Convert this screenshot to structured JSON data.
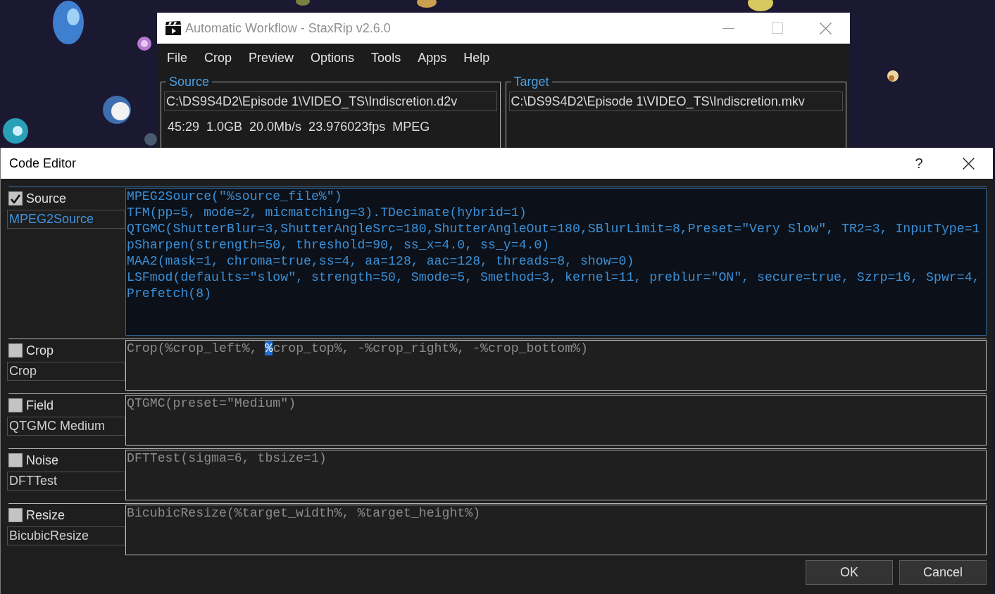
{
  "main_window": {
    "title": "Automatic Workflow - StaxRip v2.6.0",
    "menu": [
      "File",
      "Crop",
      "Preview",
      "Options",
      "Tools",
      "Apps",
      "Help"
    ],
    "source": {
      "label": "Source",
      "path": "C:\\DS9S4D2\\Episode 1\\VIDEO_TS\\Indiscretion.d2v",
      "info": "45:29  1.0GB  20.0Mb/s  23.976023fps  MPEG"
    },
    "target": {
      "label": "Target",
      "path": "C:\\DS9S4D2\\Episode 1\\VIDEO_TS\\Indiscretion.mkv"
    }
  },
  "code_editor": {
    "title": "Code Editor",
    "help_button": "?",
    "filters": [
      {
        "category": "Source",
        "checked": true,
        "selected": true,
        "name": "MPEG2Source",
        "code": [
          [
            {
              "text": "MPEG2Source(\"%source_file%\")",
              "selected": false
            }
          ],
          [
            {
              "text": "TFM(pp=5, mode=2, micmatching=3).TDecimate(hybrid=1)",
              "selected": false
            }
          ],
          [
            {
              "text": "QTGMC(ShutterBlur=3,ShutterAngleSrc=180,ShutterAngleOut=180,SBlurLimit=8,Preset=\"Very Slow\", TR2=3, InputType=1",
              "selected": false
            }
          ],
          [
            {
              "text": "pSharpen(strength=50, threshold=90, ss_x=4.0, ss_y=4.0)",
              "selected": false
            }
          ],
          [
            {
              "text": "MAA2(mask=1, chroma=true,ss=4, aa=128, aac=128, threads=8, show=0)",
              "selected": false
            }
          ],
          [
            {
              "text": "LSFmod(defaults=\"slow\", strength=50, Smode=5, Smethod=3, kernel=11, preblur=\"ON\", secure=true, Szrp=16, Spwr=4,",
              "selected": false
            }
          ],
          [
            {
              "text": "Prefetch(8)",
              "selected": false
            }
          ]
        ]
      },
      {
        "category": "Crop",
        "checked": false,
        "selected": false,
        "name": "Crop",
        "code": [
          [
            {
              "text": "Crop(%crop_left%, ",
              "selected": false
            },
            {
              "text": "%",
              "selected": true
            },
            {
              "text": "crop_top%, -%crop_right%, -%crop_bottom%)",
              "selected": false
            }
          ]
        ]
      },
      {
        "category": "Field",
        "checked": false,
        "selected": false,
        "name": "QTGMC Medium",
        "code": [
          [
            {
              "text": "QTGMC(preset=\"Medium\")",
              "selected": false
            }
          ]
        ]
      },
      {
        "category": "Noise",
        "checked": false,
        "selected": false,
        "name": "DFTTest",
        "code": [
          [
            {
              "text": "DFTTest(sigma=6, tbsize=1)",
              "selected": false
            }
          ]
        ]
      },
      {
        "category": "Resize",
        "checked": false,
        "selected": false,
        "name": "BicubicResize",
        "code": [
          [
            {
              "text": "BicubicResize(%target_width%, %target_height%)",
              "selected": false
            }
          ]
        ]
      }
    ],
    "buttons": [
      "OK",
      "Cancel"
    ]
  }
}
